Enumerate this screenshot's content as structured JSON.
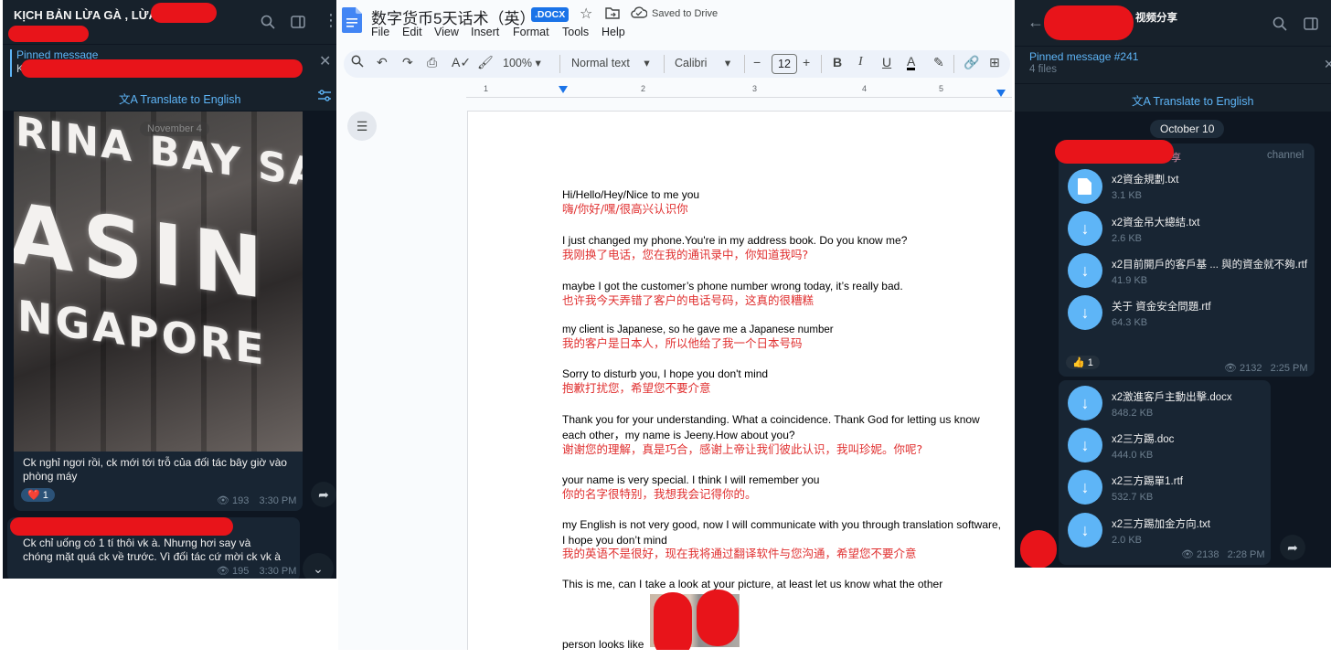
{
  "left_chat": {
    "title": "KỊCH BẢN LỪA GÀ , LỪA ĐẢO",
    "pinned_label": "Pinned message",
    "pinned_preview": "K",
    "translate_label": "Translate to English",
    "date_label": "November 4",
    "photo_sign": {
      "line1": "RINA BAY SA",
      "line2": "ASIN",
      "line3": "NGAPORE"
    },
    "message1": {
      "text": "Ck nghỉ ngơi rồi, ck mới tới trỗ của đối tác bây giờ vào phòng máy",
      "reaction": "❤️ 1",
      "views": "193",
      "time": "3:30 PM"
    },
    "message2": {
      "text": "Ck chỉ uống có 1 tí thôi vk à. Nhưng hơi say và chóng mặt quá ck về trước. Vì đối tác cứ mời ck vk à",
      "views": "195",
      "time": "3:30 PM"
    },
    "icons": {
      "search": "search-icon",
      "sidebar": "sidebar-toggle-icon",
      "more": "more-icon",
      "close": "close-icon",
      "filter": "filter-icon",
      "forward": "forward-icon",
      "down": "chevron-down-icon"
    }
  },
  "doc": {
    "title": "数字货币5天话术（英）",
    "badge": ".DOCX",
    "saved": "Saved to Drive",
    "menu": [
      "File",
      "Edit",
      "View",
      "Insert",
      "Format",
      "Tools",
      "Help"
    ],
    "zoom": "100%",
    "style": "Normal text",
    "font": "Calibri",
    "font_size": "12",
    "ruler_numbers": [
      "1",
      "2",
      "3",
      "4",
      "5"
    ],
    "lines": [
      {
        "en": "Hi/Hello/Hey/Nice to me you",
        "zh": "嗨/你好/嘿/很高兴认识你"
      },
      {
        "en": "I just changed my phone.You're in my address book. Do you know me?",
        "zh": "我刚换了电话，您在我的通讯录中，你知道我吗?"
      },
      {
        "en": "maybe I got the customer’s phone number wrong today, it’s really bad.",
        "zh": "也许我今天弄错了客户的电话号码，这真的很糟糕"
      },
      {
        "en": "my client is Japanese, so he gave me a Japanese number",
        "zh": "我的客户是日本人，所以他给了我一个日本号码"
      },
      {
        "en": "Sorry to disturb you, I hope you don't mind",
        "zh": "抱歉打扰您，希望您不要介意"
      },
      {
        "en": "Thank you for your understanding. What a coincidence. Thank God for letting us know each other，my name is Jeeny.How about you?",
        "zh": "谢谢您的理解，真是巧合，感谢上帝让我们彼此认识，我叫珍妮。你呢?"
      },
      {
        "en": "your name is very special. I think I will remember you",
        "zh": "你的名字很特别，我想我会记得你的。"
      },
      {
        "en": "my English is not very good, now I will communicate with you through translation software, I hope you don’t mind",
        "zh": "我的英语不是很好，现在我将通过翻译软件与您沟通，希望您不要介意"
      },
      {
        "en": "This is me, can I take a look at your picture, at least let us know what the other",
        "zh": ""
      },
      {
        "en": "person looks like",
        "zh": ""
      }
    ],
    "accent_color": "#1a73e8",
    "translation_color": "#e03030"
  },
  "right_chat": {
    "title": "视频分享",
    "pinned_label": "Pinned message #241",
    "pinned_sub": "4 files",
    "translate_label": "Translate to English",
    "date_label": "October 10",
    "sender_suffix": "分享",
    "channel_label": "channel",
    "group1": [
      {
        "name": "x2資金規劃.txt",
        "size": "3.1 KB",
        "icon": "file-icon"
      },
      {
        "name": "x2資金吊大總結.txt",
        "size": "2.6 KB",
        "icon": "download-icon"
      },
      {
        "name": "x2目前開戶的客戶基 ... 與的資金就不夠.rtf",
        "size": "41.9 KB",
        "icon": "download-icon"
      },
      {
        "name": "关于 資金安全問題.rtf",
        "size": "64.3 KB",
        "icon": "download-icon"
      }
    ],
    "group1_reaction": "👍 1",
    "group1_views": "2132",
    "group1_time": "2:25 PM",
    "group2": [
      {
        "name": "x2激進客戶主動出擊.docx",
        "size": "848.2 KB",
        "icon": "download-icon"
      },
      {
        "name": "x2三方踢.doc",
        "size": "444.0 KB",
        "icon": "download-icon"
      },
      {
        "name": "x2三方踢單1.rtf",
        "size": "532.7 KB",
        "icon": "download-icon"
      },
      {
        "name": "x2三方踢加金方向.txt",
        "size": "2.0 KB",
        "icon": "download-icon"
      }
    ],
    "group2_views": "2138",
    "group2_time": "2:28 PM"
  }
}
